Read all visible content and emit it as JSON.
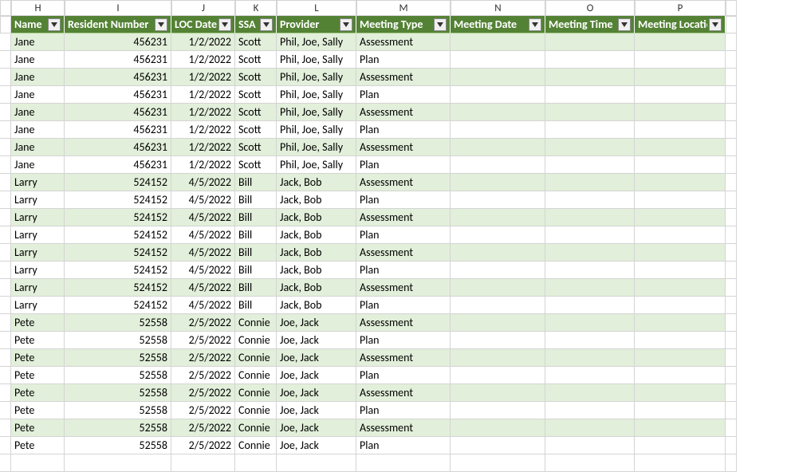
{
  "columns": [
    "H",
    "I",
    "J",
    "K",
    "L",
    "M",
    "N",
    "O",
    "P"
  ],
  "headers": [
    "Name",
    "Resident Number",
    "LOC Date",
    "SSA",
    "Provider",
    "Meeting Type",
    "Meeting Date",
    "Meeting Time",
    "Meeting Location"
  ],
  "rows": [
    {
      "name": "Jane",
      "resident_number": "456231",
      "loc_date": "1/2/2022",
      "ssa": "Scott",
      "provider": "Phil, Joe, Sally",
      "meeting_type": "Assessment",
      "meeting_date": "",
      "meeting_time": "",
      "meeting_location": ""
    },
    {
      "name": "Jane",
      "resident_number": "456231",
      "loc_date": "1/2/2022",
      "ssa": "Scott",
      "provider": "Phil, Joe, Sally",
      "meeting_type": "Plan",
      "meeting_date": "",
      "meeting_time": "",
      "meeting_location": ""
    },
    {
      "name": "Jane",
      "resident_number": "456231",
      "loc_date": "1/2/2022",
      "ssa": "Scott",
      "provider": "Phil, Joe, Sally",
      "meeting_type": "Assessment",
      "meeting_date": "",
      "meeting_time": "",
      "meeting_location": ""
    },
    {
      "name": "Jane",
      "resident_number": "456231",
      "loc_date": "1/2/2022",
      "ssa": "Scott",
      "provider": "Phil, Joe, Sally",
      "meeting_type": "Plan",
      "meeting_date": "",
      "meeting_time": "",
      "meeting_location": ""
    },
    {
      "name": "Jane",
      "resident_number": "456231",
      "loc_date": "1/2/2022",
      "ssa": "Scott",
      "provider": "Phil, Joe, Sally",
      "meeting_type": "Assessment",
      "meeting_date": "",
      "meeting_time": "",
      "meeting_location": ""
    },
    {
      "name": "Jane",
      "resident_number": "456231",
      "loc_date": "1/2/2022",
      "ssa": "Scott",
      "provider": "Phil, Joe, Sally",
      "meeting_type": "Plan",
      "meeting_date": "",
      "meeting_time": "",
      "meeting_location": ""
    },
    {
      "name": "Jane",
      "resident_number": "456231",
      "loc_date": "1/2/2022",
      "ssa": "Scott",
      "provider": "Phil, Joe, Sally",
      "meeting_type": "Assessment",
      "meeting_date": "",
      "meeting_time": "",
      "meeting_location": ""
    },
    {
      "name": "Jane",
      "resident_number": "456231",
      "loc_date": "1/2/2022",
      "ssa": "Scott",
      "provider": "Phil, Joe, Sally",
      "meeting_type": "Plan",
      "meeting_date": "",
      "meeting_time": "",
      "meeting_location": ""
    },
    {
      "name": "Larry",
      "resident_number": "524152",
      "loc_date": "4/5/2022",
      "ssa": "Bill",
      "provider": "Jack, Bob",
      "meeting_type": "Assessment",
      "meeting_date": "",
      "meeting_time": "",
      "meeting_location": ""
    },
    {
      "name": "Larry",
      "resident_number": "524152",
      "loc_date": "4/5/2022",
      "ssa": "Bill",
      "provider": "Jack, Bob",
      "meeting_type": "Plan",
      "meeting_date": "",
      "meeting_time": "",
      "meeting_location": ""
    },
    {
      "name": "Larry",
      "resident_number": "524152",
      "loc_date": "4/5/2022",
      "ssa": "Bill",
      "provider": "Jack, Bob",
      "meeting_type": "Assessment",
      "meeting_date": "",
      "meeting_time": "",
      "meeting_location": ""
    },
    {
      "name": "Larry",
      "resident_number": "524152",
      "loc_date": "4/5/2022",
      "ssa": "Bill",
      "provider": "Jack, Bob",
      "meeting_type": "Plan",
      "meeting_date": "",
      "meeting_time": "",
      "meeting_location": ""
    },
    {
      "name": "Larry",
      "resident_number": "524152",
      "loc_date": "4/5/2022",
      "ssa": "Bill",
      "provider": "Jack, Bob",
      "meeting_type": "Assessment",
      "meeting_date": "",
      "meeting_time": "",
      "meeting_location": ""
    },
    {
      "name": "Larry",
      "resident_number": "524152",
      "loc_date": "4/5/2022",
      "ssa": "Bill",
      "provider": "Jack, Bob",
      "meeting_type": "Plan",
      "meeting_date": "",
      "meeting_time": "",
      "meeting_location": ""
    },
    {
      "name": "Larry",
      "resident_number": "524152",
      "loc_date": "4/5/2022",
      "ssa": "Bill",
      "provider": "Jack, Bob",
      "meeting_type": "Assessment",
      "meeting_date": "",
      "meeting_time": "",
      "meeting_location": ""
    },
    {
      "name": "Larry",
      "resident_number": "524152",
      "loc_date": "4/5/2022",
      "ssa": "Bill",
      "provider": "Jack, Bob",
      "meeting_type": "Plan",
      "meeting_date": "",
      "meeting_time": "",
      "meeting_location": ""
    },
    {
      "name": "Pete",
      "resident_number": "52558",
      "loc_date": "2/5/2022",
      "ssa": "Connie",
      "provider": "Joe, Jack",
      "meeting_type": "Assessment",
      "meeting_date": "",
      "meeting_time": "",
      "meeting_location": ""
    },
    {
      "name": "Pete",
      "resident_number": "52558",
      "loc_date": "2/5/2022",
      "ssa": "Connie",
      "provider": "Joe, Jack",
      "meeting_type": "Plan",
      "meeting_date": "",
      "meeting_time": "",
      "meeting_location": ""
    },
    {
      "name": "Pete",
      "resident_number": "52558",
      "loc_date": "2/5/2022",
      "ssa": "Connie",
      "provider": "Joe, Jack",
      "meeting_type": "Assessment",
      "meeting_date": "",
      "meeting_time": "",
      "meeting_location": ""
    },
    {
      "name": "Pete",
      "resident_number": "52558",
      "loc_date": "2/5/2022",
      "ssa": "Connie",
      "provider": "Joe, Jack",
      "meeting_type": "Plan",
      "meeting_date": "",
      "meeting_time": "",
      "meeting_location": ""
    },
    {
      "name": "Pete",
      "resident_number": "52558",
      "loc_date": "2/5/2022",
      "ssa": "Connie",
      "provider": "Joe, Jack",
      "meeting_type": "Assessment",
      "meeting_date": "",
      "meeting_time": "",
      "meeting_location": ""
    },
    {
      "name": "Pete",
      "resident_number": "52558",
      "loc_date": "2/5/2022",
      "ssa": "Connie",
      "provider": "Joe, Jack",
      "meeting_type": "Plan",
      "meeting_date": "",
      "meeting_time": "",
      "meeting_location": ""
    },
    {
      "name": "Pete",
      "resident_number": "52558",
      "loc_date": "2/5/2022",
      "ssa": "Connie",
      "provider": "Joe, Jack",
      "meeting_type": "Assessment",
      "meeting_date": "",
      "meeting_time": "",
      "meeting_location": ""
    },
    {
      "name": "Pete",
      "resident_number": "52558",
      "loc_date": "2/5/2022",
      "ssa": "Connie",
      "provider": "Joe, Jack",
      "meeting_type": "Plan",
      "meeting_date": "",
      "meeting_time": "",
      "meeting_location": ""
    }
  ]
}
